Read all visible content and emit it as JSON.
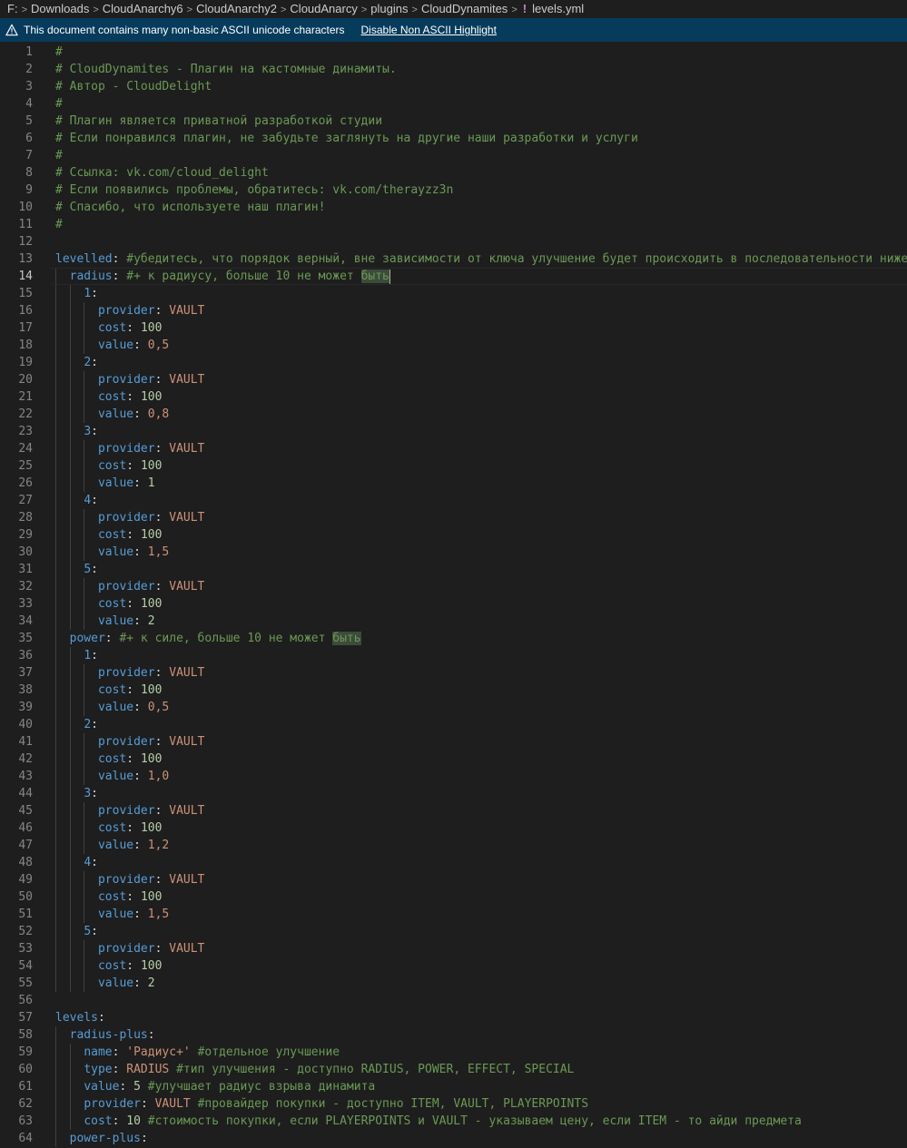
{
  "breadcrumb": {
    "items": [
      "F:",
      "Downloads",
      "CloudAnarchy6",
      "CloudAnarchy2",
      "CloudAnarcy",
      "plugins",
      "CloudDynamites"
    ],
    "file_icon": "!",
    "file": "levels.yml"
  },
  "banner": {
    "message": "This document contains many non-basic ASCII unicode characters",
    "action": "Disable Non ASCII Highlight"
  },
  "editor": {
    "active_line": 14,
    "lines": [
      [
        [
          "c",
          "#"
        ]
      ],
      [
        [
          "c",
          "# CloudDynamites - Плагин на кастомные динамиты."
        ]
      ],
      [
        [
          "c",
          "# Автор - CloudDelight"
        ]
      ],
      [
        [
          "c",
          "#"
        ]
      ],
      [
        [
          "c",
          "# Плагин является приватной разработкой студии"
        ]
      ],
      [
        [
          "c",
          "# Если понравился плагин, не забудьте заглянуть на другие наши разработки и услуги"
        ]
      ],
      [
        [
          "c",
          "#"
        ]
      ],
      [
        [
          "c",
          "# Ссылка: vk.com/cloud_delight"
        ]
      ],
      [
        [
          "c",
          "# Если появились проблемы, обратитесь: vk.com/therayzz3n"
        ]
      ],
      [
        [
          "c",
          "# Спасибо, что используете наш плагин!"
        ]
      ],
      [
        [
          "c",
          "#"
        ]
      ],
      [],
      [
        [
          "k",
          "levelled"
        ],
        [
          "p",
          ": "
        ],
        [
          "c",
          "#убедитесь, что порядок верный, вне зависимости от ключа улучшение будет происходить в последовательности ниже"
        ]
      ],
      [
        [
          "p",
          "  "
        ],
        [
          "k",
          "radius"
        ],
        [
          "p",
          ": "
        ],
        [
          "c",
          "#+ к радиусу, больше 10 не может "
        ],
        [
          "hl",
          "быть"
        ],
        [
          "cur",
          ""
        ]
      ],
      [
        [
          "p",
          "    "
        ],
        [
          "k",
          "1"
        ],
        [
          "p",
          ":"
        ]
      ],
      [
        [
          "p",
          "      "
        ],
        [
          "k",
          "provider"
        ],
        [
          "p",
          ": "
        ],
        [
          "s",
          "VAULT"
        ]
      ],
      [
        [
          "p",
          "      "
        ],
        [
          "k",
          "cost"
        ],
        [
          "p",
          ": "
        ],
        [
          "n",
          "100"
        ]
      ],
      [
        [
          "p",
          "      "
        ],
        [
          "k",
          "value"
        ],
        [
          "p",
          ": "
        ],
        [
          "s",
          "0,5"
        ]
      ],
      [
        [
          "p",
          "    "
        ],
        [
          "k",
          "2"
        ],
        [
          "p",
          ":"
        ]
      ],
      [
        [
          "p",
          "      "
        ],
        [
          "k",
          "provider"
        ],
        [
          "p",
          ": "
        ],
        [
          "s",
          "VAULT"
        ]
      ],
      [
        [
          "p",
          "      "
        ],
        [
          "k",
          "cost"
        ],
        [
          "p",
          ": "
        ],
        [
          "n",
          "100"
        ]
      ],
      [
        [
          "p",
          "      "
        ],
        [
          "k",
          "value"
        ],
        [
          "p",
          ": "
        ],
        [
          "s",
          "0,8"
        ]
      ],
      [
        [
          "p",
          "    "
        ],
        [
          "k",
          "3"
        ],
        [
          "p",
          ":"
        ]
      ],
      [
        [
          "p",
          "      "
        ],
        [
          "k",
          "provider"
        ],
        [
          "p",
          ": "
        ],
        [
          "s",
          "VAULT"
        ]
      ],
      [
        [
          "p",
          "      "
        ],
        [
          "k",
          "cost"
        ],
        [
          "p",
          ": "
        ],
        [
          "n",
          "100"
        ]
      ],
      [
        [
          "p",
          "      "
        ],
        [
          "k",
          "value"
        ],
        [
          "p",
          ": "
        ],
        [
          "n",
          "1"
        ]
      ],
      [
        [
          "p",
          "    "
        ],
        [
          "k",
          "4"
        ],
        [
          "p",
          ":"
        ]
      ],
      [
        [
          "p",
          "      "
        ],
        [
          "k",
          "provider"
        ],
        [
          "p",
          ": "
        ],
        [
          "s",
          "VAULT"
        ]
      ],
      [
        [
          "p",
          "      "
        ],
        [
          "k",
          "cost"
        ],
        [
          "p",
          ": "
        ],
        [
          "n",
          "100"
        ]
      ],
      [
        [
          "p",
          "      "
        ],
        [
          "k",
          "value"
        ],
        [
          "p",
          ": "
        ],
        [
          "s",
          "1,5"
        ]
      ],
      [
        [
          "p",
          "    "
        ],
        [
          "k",
          "5"
        ],
        [
          "p",
          ":"
        ]
      ],
      [
        [
          "p",
          "      "
        ],
        [
          "k",
          "provider"
        ],
        [
          "p",
          ": "
        ],
        [
          "s",
          "VAULT"
        ]
      ],
      [
        [
          "p",
          "      "
        ],
        [
          "k",
          "cost"
        ],
        [
          "p",
          ": "
        ],
        [
          "n",
          "100"
        ]
      ],
      [
        [
          "p",
          "      "
        ],
        [
          "k",
          "value"
        ],
        [
          "p",
          ": "
        ],
        [
          "n",
          "2"
        ]
      ],
      [
        [
          "p",
          "  "
        ],
        [
          "k",
          "power"
        ],
        [
          "p",
          ": "
        ],
        [
          "c",
          "#+ к силе, больше 10 не может "
        ],
        [
          "hl",
          "быть"
        ]
      ],
      [
        [
          "p",
          "    "
        ],
        [
          "k",
          "1"
        ],
        [
          "p",
          ":"
        ]
      ],
      [
        [
          "p",
          "      "
        ],
        [
          "k",
          "provider"
        ],
        [
          "p",
          ": "
        ],
        [
          "s",
          "VAULT"
        ]
      ],
      [
        [
          "p",
          "      "
        ],
        [
          "k",
          "cost"
        ],
        [
          "p",
          ": "
        ],
        [
          "n",
          "100"
        ]
      ],
      [
        [
          "p",
          "      "
        ],
        [
          "k",
          "value"
        ],
        [
          "p",
          ": "
        ],
        [
          "s",
          "0,5"
        ]
      ],
      [
        [
          "p",
          "    "
        ],
        [
          "k",
          "2"
        ],
        [
          "p",
          ":"
        ]
      ],
      [
        [
          "p",
          "      "
        ],
        [
          "k",
          "provider"
        ],
        [
          "p",
          ": "
        ],
        [
          "s",
          "VAULT"
        ]
      ],
      [
        [
          "p",
          "      "
        ],
        [
          "k",
          "cost"
        ],
        [
          "p",
          ": "
        ],
        [
          "n",
          "100"
        ]
      ],
      [
        [
          "p",
          "      "
        ],
        [
          "k",
          "value"
        ],
        [
          "p",
          ": "
        ],
        [
          "s",
          "1,0"
        ]
      ],
      [
        [
          "p",
          "    "
        ],
        [
          "k",
          "3"
        ],
        [
          "p",
          ":"
        ]
      ],
      [
        [
          "p",
          "      "
        ],
        [
          "k",
          "provider"
        ],
        [
          "p",
          ": "
        ],
        [
          "s",
          "VAULT"
        ]
      ],
      [
        [
          "p",
          "      "
        ],
        [
          "k",
          "cost"
        ],
        [
          "p",
          ": "
        ],
        [
          "n",
          "100"
        ]
      ],
      [
        [
          "p",
          "      "
        ],
        [
          "k",
          "value"
        ],
        [
          "p",
          ": "
        ],
        [
          "s",
          "1,2"
        ]
      ],
      [
        [
          "p",
          "    "
        ],
        [
          "k",
          "4"
        ],
        [
          "p",
          ":"
        ]
      ],
      [
        [
          "p",
          "      "
        ],
        [
          "k",
          "provider"
        ],
        [
          "p",
          ": "
        ],
        [
          "s",
          "VAULT"
        ]
      ],
      [
        [
          "p",
          "      "
        ],
        [
          "k",
          "cost"
        ],
        [
          "p",
          ": "
        ],
        [
          "n",
          "100"
        ]
      ],
      [
        [
          "p",
          "      "
        ],
        [
          "k",
          "value"
        ],
        [
          "p",
          ": "
        ],
        [
          "s",
          "1,5"
        ]
      ],
      [
        [
          "p",
          "    "
        ],
        [
          "k",
          "5"
        ],
        [
          "p",
          ":"
        ]
      ],
      [
        [
          "p",
          "      "
        ],
        [
          "k",
          "provider"
        ],
        [
          "p",
          ": "
        ],
        [
          "s",
          "VAULT"
        ]
      ],
      [
        [
          "p",
          "      "
        ],
        [
          "k",
          "cost"
        ],
        [
          "p",
          ": "
        ],
        [
          "n",
          "100"
        ]
      ],
      [
        [
          "p",
          "      "
        ],
        [
          "k",
          "value"
        ],
        [
          "p",
          ": "
        ],
        [
          "n",
          "2"
        ]
      ],
      [],
      [
        [
          "k",
          "levels"
        ],
        [
          "p",
          ":"
        ]
      ],
      [
        [
          "p",
          "  "
        ],
        [
          "k",
          "radius-plus"
        ],
        [
          "p",
          ":"
        ]
      ],
      [
        [
          "p",
          "    "
        ],
        [
          "k",
          "name"
        ],
        [
          "p",
          ": "
        ],
        [
          "s",
          "'Радиус+'"
        ],
        [
          "p",
          " "
        ],
        [
          "c",
          "#отдельное улучшение"
        ]
      ],
      [
        [
          "p",
          "    "
        ],
        [
          "k",
          "type"
        ],
        [
          "p",
          ": "
        ],
        [
          "s",
          "RADIUS"
        ],
        [
          "p",
          " "
        ],
        [
          "c",
          "#тип улучшения - доступно RADIUS, POWER, EFFECT, SPECIAL"
        ]
      ],
      [
        [
          "p",
          "    "
        ],
        [
          "k",
          "value"
        ],
        [
          "p",
          ": "
        ],
        [
          "n",
          "5"
        ],
        [
          "p",
          " "
        ],
        [
          "c",
          "#улучшает радиус взрыва динамита"
        ]
      ],
      [
        [
          "p",
          "    "
        ],
        [
          "k",
          "provider"
        ],
        [
          "p",
          ": "
        ],
        [
          "s",
          "VAULT"
        ],
        [
          "p",
          " "
        ],
        [
          "c",
          "#провайдер покупки - доступно ITEM, VAULT, PLAYERPOINTS"
        ]
      ],
      [
        [
          "p",
          "    "
        ],
        [
          "k",
          "cost"
        ],
        [
          "p",
          ": "
        ],
        [
          "n",
          "10"
        ],
        [
          "p",
          " "
        ],
        [
          "c",
          "#стоимость покупки, если PLAYERPOINTS и VAULT - указываем цену, если ITEM - то айди предмета"
        ]
      ],
      [
        [
          "p",
          "  "
        ],
        [
          "k",
          "power-plus"
        ],
        [
          "p",
          ":"
        ]
      ]
    ]
  }
}
